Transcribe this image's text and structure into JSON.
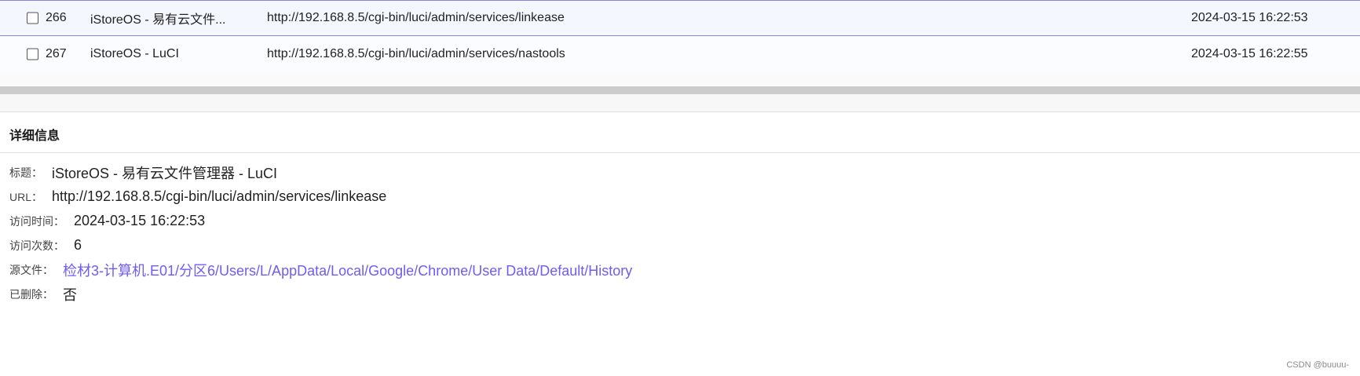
{
  "rows": [
    {
      "id": "266",
      "title": "iStoreOS - 易有云文件...",
      "url": "http://192.168.8.5/cgi-bin/luci/admin/services/linkease",
      "time": "2024-03-15 16:22:53"
    },
    {
      "id": "267",
      "title": "iStoreOS - LuCI",
      "url": "http://192.168.8.5/cgi-bin/luci/admin/services/nastools",
      "time": "2024-03-15 16:22:55"
    }
  ],
  "detail": {
    "header": "详细信息",
    "fields": {
      "title": {
        "label": "标题：",
        "value": "iStoreOS - 易有云文件管理器 - LuCI"
      },
      "url": {
        "label": "URL：",
        "value": "http://192.168.8.5/cgi-bin/luci/admin/services/linkease"
      },
      "visit_time": {
        "label": "访问时间：",
        "value": "2024-03-15 16:22:53"
      },
      "visit_count": {
        "label": "访问次数：",
        "value": "6"
      },
      "source_file": {
        "label": "源文件：",
        "value": "检材3-计算机.E01/分区6/Users/L/AppData/Local/Google/Chrome/User Data/Default/History"
      },
      "deleted": {
        "label": "已删除：",
        "value": "否"
      }
    }
  },
  "watermark": "CSDN @buuuu-"
}
